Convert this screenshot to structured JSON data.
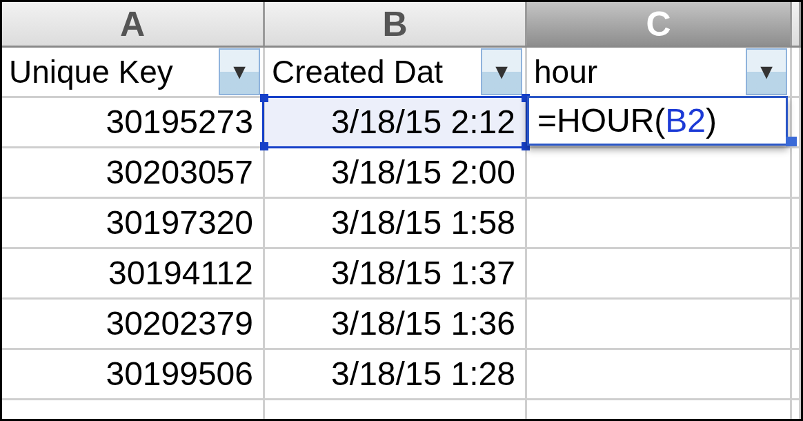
{
  "columns": [
    {
      "letter": "A",
      "selected": false
    },
    {
      "letter": "B",
      "selected": false
    },
    {
      "letter": "C",
      "selected": true
    }
  ],
  "header_row": [
    {
      "label": "Unique Key",
      "filter": "▼"
    },
    {
      "label": "Created Dat",
      "filter": "▼"
    },
    {
      "label": "hour",
      "filter": "▼"
    }
  ],
  "rows": [
    {
      "unique_key": "30195273",
      "created_date": "3/18/15 2:12",
      "selected": true
    },
    {
      "unique_key": "30203057",
      "created_date": "3/18/15 2:00",
      "selected": false
    },
    {
      "unique_key": "30197320",
      "created_date": "3/18/15 1:58",
      "selected": false
    },
    {
      "unique_key": "30194112",
      "created_date": "3/18/15 1:37",
      "selected": false
    },
    {
      "unique_key": "30202379",
      "created_date": "3/18/15 1:36",
      "selected": false
    },
    {
      "unique_key": "30199506",
      "created_date": "3/18/15 1:28",
      "selected": false
    }
  ],
  "editing_cell": {
    "parts": [
      {
        "text": "=HOUR(",
        "kind": "plain"
      },
      {
        "text": "B2",
        "kind": "reference"
      },
      {
        "text": ")",
        "kind": "plain"
      }
    ]
  }
}
